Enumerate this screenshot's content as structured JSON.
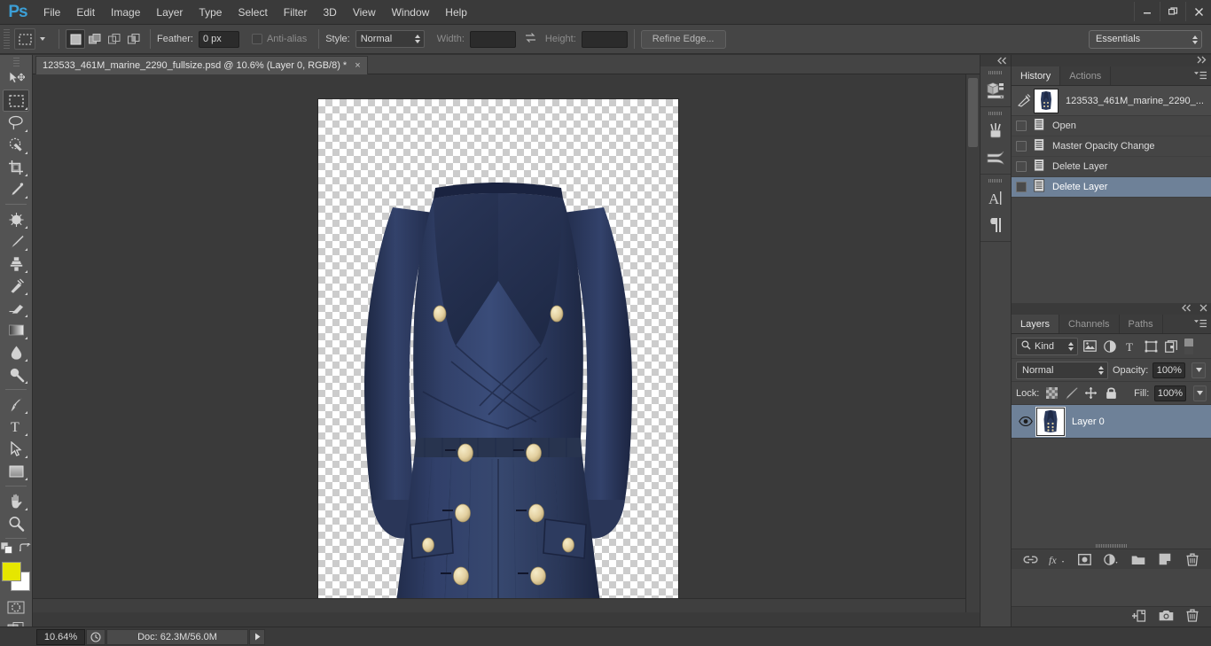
{
  "app": {
    "logo": "Ps",
    "menus": [
      "File",
      "Edit",
      "Image",
      "Layer",
      "Type",
      "Select",
      "Filter",
      "3D",
      "View",
      "Window",
      "Help"
    ],
    "window_controls": [
      "minimize",
      "restore",
      "close"
    ],
    "theme_bg": "#333333",
    "accent_selection": "#6e8198",
    "foreground_color": "#e6e600",
    "background_color": "#ffffff"
  },
  "options_bar": {
    "tool_preset_icon": "marquee-icon",
    "selection_modes": [
      "new-selection",
      "add-to-selection",
      "subtract-from-selection",
      "intersect-with-selection"
    ],
    "active_selection_mode": 0,
    "feather_label": "Feather:",
    "feather_value": "0 px",
    "antialias_label": "Anti-alias",
    "antialias_checked": false,
    "style_label": "Style:",
    "style_value": "Normal",
    "width_label": "Width:",
    "width_value": "",
    "height_label": "Height:",
    "height_value": "",
    "swap_icon": "swap-dimensions-icon",
    "refine_edge_label": "Refine Edge...",
    "workspace_value": "Essentials"
  },
  "toolbar": {
    "tools": [
      {
        "name": "move-tool",
        "has_submenu": false,
        "selected": false
      },
      {
        "name": "rectangular-marquee-tool",
        "has_submenu": true,
        "selected": true
      },
      {
        "name": "lasso-tool",
        "has_submenu": true,
        "selected": false
      },
      {
        "name": "quick-selection-tool",
        "has_submenu": true,
        "selected": false
      },
      {
        "name": "crop-tool",
        "has_submenu": true,
        "selected": false
      },
      {
        "name": "eyedropper-tool",
        "has_submenu": true,
        "selected": false
      },
      {
        "name": "spot-healing-brush-tool",
        "has_submenu": true,
        "selected": false
      },
      {
        "name": "brush-tool",
        "has_submenu": true,
        "selected": false
      },
      {
        "name": "clone-stamp-tool",
        "has_submenu": true,
        "selected": false
      },
      {
        "name": "history-brush-tool",
        "has_submenu": true,
        "selected": false
      },
      {
        "name": "eraser-tool",
        "has_submenu": true,
        "selected": false
      },
      {
        "name": "gradient-tool",
        "has_submenu": true,
        "selected": false
      },
      {
        "name": "blur-tool",
        "has_submenu": true,
        "selected": false
      },
      {
        "name": "dodge-tool",
        "has_submenu": true,
        "selected": false
      },
      {
        "name": "pen-tool",
        "has_submenu": true,
        "selected": false
      },
      {
        "name": "horizontal-type-tool",
        "has_submenu": true,
        "selected": false
      },
      {
        "name": "path-selection-tool",
        "has_submenu": true,
        "selected": false
      },
      {
        "name": "rectangle-tool",
        "has_submenu": true,
        "selected": false
      },
      {
        "name": "hand-tool",
        "has_submenu": true,
        "selected": false
      },
      {
        "name": "zoom-tool",
        "has_submenu": false,
        "selected": false
      }
    ],
    "quick_mask_label": "quick-mask-mode",
    "screen_mode_label": "screen-mode"
  },
  "document": {
    "tab_title": "123533_461M_marine_2290_fullsize.psd @ 10.6% (Layer 0, RGB/8) *",
    "close_glyph": "×",
    "canvas_background": "transparent-checkerboard"
  },
  "status_bar": {
    "zoom": "10.64%",
    "clock_icon": "timing-icon",
    "doc_info": "Doc: 62.3M/56.0M",
    "expand_icon": "play-arrow-icon"
  },
  "icon_dock": {
    "collapse_icon": "collapse-to-icons",
    "groups": [
      [
        {
          "name": "mini-bridge-icon"
        }
      ],
      [
        {
          "name": "brush-presets-icon"
        },
        {
          "name": "brush-icon"
        }
      ],
      [
        {
          "name": "character-panel-icon",
          "glyph": "A"
        },
        {
          "name": "paragraph-panel-icon",
          "glyph": "¶"
        }
      ]
    ]
  },
  "history_panel": {
    "expand_icon": "expand-panels-icon",
    "tabs": [
      {
        "label": "History",
        "active": true
      },
      {
        "label": "Actions",
        "active": false
      }
    ],
    "menu_icon": "panel-menu-icon",
    "snapshot": {
      "label": "123533_461M_marine_2290_...",
      "icon": "history-brush-source-icon"
    },
    "states": [
      {
        "label": "Open",
        "selected": false
      },
      {
        "label": "Master Opacity Change",
        "selected": false
      },
      {
        "label": "Delete Layer",
        "selected": false
      },
      {
        "label": "Delete Layer",
        "selected": true
      }
    ],
    "footer_icons": [
      "new-document-from-state-icon",
      "create-snapshot-icon",
      "delete-state-icon"
    ]
  },
  "layers_panel": {
    "collapse_icon": "collapse-icon",
    "close_icon": "close-icon",
    "tabs": [
      {
        "label": "Layers",
        "active": true
      },
      {
        "label": "Channels",
        "active": false
      },
      {
        "label": "Paths",
        "active": false
      }
    ],
    "menu_icon": "panel-menu-icon",
    "filter": {
      "kind_label": "Kind",
      "search_icon": "search-icon",
      "type_filters": [
        "pixel-layer-filter-icon",
        "adjustment-layer-filter-icon",
        "type-layer-filter-icon",
        "shape-layer-filter-icon",
        "smart-object-filter-icon"
      ],
      "toggle_icon": "filter-toggle-switch"
    },
    "blend_mode": "Normal",
    "opacity_label": "Opacity:",
    "opacity_value": "100%",
    "lock_label": "Lock:",
    "lock_icons": [
      "lock-transparent-pixels-icon",
      "lock-image-pixels-icon",
      "lock-position-icon",
      "lock-all-icon"
    ],
    "fill_label": "Fill:",
    "fill_value": "100%",
    "layers": [
      {
        "name": "Layer 0",
        "visible": true,
        "selected": true
      }
    ],
    "footer_icons": [
      "link-layers-icon",
      "layer-style-icon",
      "layer-mask-icon",
      "adjustment-layer-icon",
      "layer-group-icon",
      "new-layer-icon",
      "delete-layer-icon"
    ]
  },
  "artwork": {
    "description": "navy-blue-double-breasted-wrap-dress-with-gold-buttons",
    "fabric_color": "#2b3a5c",
    "fabric_shadow": "#1b2540",
    "fabric_highlight": "#3b4d75",
    "button_color": "#e8d9a8",
    "button_shadow": "#b9a474"
  }
}
